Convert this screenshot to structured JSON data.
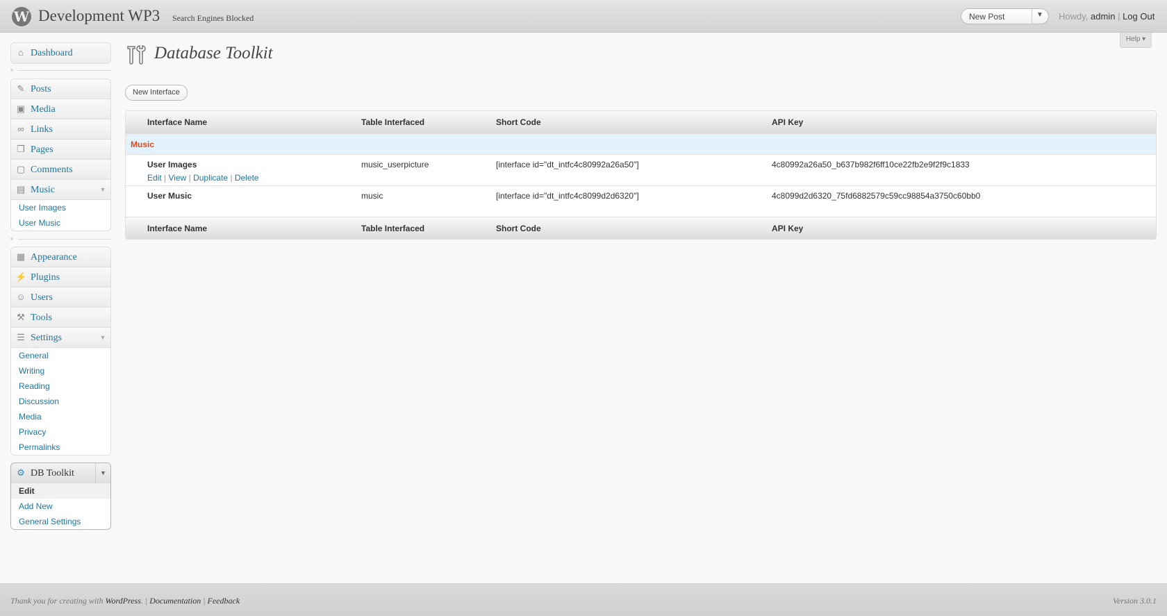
{
  "header": {
    "logo_letter": "W",
    "site_title": "Development WP3",
    "site_visibility": "Search Engines Blocked",
    "new_post_label": "New Post",
    "howdy": "Howdy,",
    "user": "admin",
    "separator": "|",
    "logout": "Log Out",
    "help": "Help ▾"
  },
  "sidebar": {
    "dashboard": "Dashboard",
    "posts": "Posts",
    "media": "Media",
    "links": "Links",
    "pages": "Pages",
    "comments": "Comments",
    "music": "Music",
    "music_items": [
      "User Images",
      "User Music"
    ],
    "appearance": "Appearance",
    "plugins": "Plugins",
    "users": "Users",
    "tools": "Tools",
    "settings": "Settings",
    "settings_items": [
      "General",
      "Writing",
      "Reading",
      "Discussion",
      "Media",
      "Privacy",
      "Permalinks"
    ],
    "db_toolkit": "DB Toolkit",
    "db_items": [
      "Edit",
      "Add New",
      "General Settings"
    ]
  },
  "main": {
    "title": "Database Toolkit",
    "new_interface": "New Interface",
    "columns": [
      "Interface Name",
      "Table Interfaced",
      "Short Code",
      "API Key"
    ],
    "group": "Music",
    "rows": [
      {
        "name": "User Images",
        "table": "music_userpicture",
        "shortcode": "[interface id=\"dt_intfc4c80992a26a50\"]",
        "api_key": "4c80992a26a50_b637b982f6ff10ce22fb2e9f2f9c1833"
      },
      {
        "name": "User Music",
        "table": "music",
        "shortcode": "[interface id=\"dt_intfc4c8099d2d6320\"]",
        "api_key": "4c8099d2d6320_75fd6882579c59cc98854a3750c60bb0"
      }
    ],
    "row_actions": [
      "Edit",
      "View",
      "Duplicate",
      "Delete"
    ]
  },
  "footer": {
    "thanks": "Thank you for creating with",
    "wordpress": "WordPress",
    "documentation": "Documentation",
    "feedback": "Feedback",
    "version": "Version 3.0.1"
  }
}
